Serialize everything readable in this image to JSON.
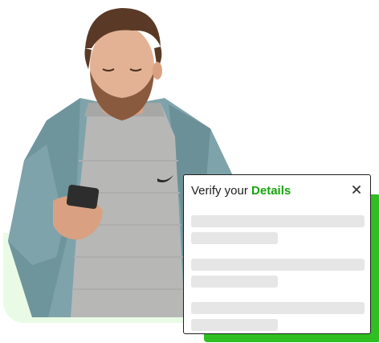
{
  "card": {
    "title_prefix": "Verify your",
    "title_accent": "Details",
    "close_glyph": "×",
    "field_groups": [
      {
        "state": "loading"
      },
      {
        "state": "loading"
      },
      {
        "state": "loading"
      }
    ]
  },
  "colors": {
    "accent": "#17a40c",
    "shadow": "#2fbf22",
    "backdrop": "#e9fbe5",
    "skeleton": "#e6e6e6"
  },
  "icons": {
    "close": "close-icon"
  }
}
